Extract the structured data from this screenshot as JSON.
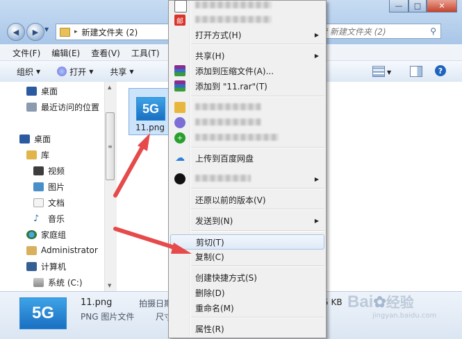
{
  "window": {
    "breadcrumb": "新建文件夹 (2)",
    "search_placeholder": "搜索 新建文件夹 (2)",
    "minimize": "—",
    "maximize": "□",
    "close": "✕"
  },
  "menubar": [
    "文件(F)",
    "编辑(E)",
    "查看(V)",
    "工具(T)"
  ],
  "toolbar": {
    "organize": "组织",
    "open": "打开",
    "share": "共享"
  },
  "navpane": {
    "favorites": [
      "桌面",
      "最近访问的位置"
    ],
    "tree": [
      "桌面",
      "库",
      "视频",
      "图片",
      "文档",
      "音乐",
      "家庭组",
      "Administrator",
      "计算机",
      "系统 (C:)"
    ]
  },
  "file": {
    "name": "11.png",
    "thumb_text": "5G"
  },
  "details": {
    "name": "11.png",
    "type": "PNG 图片文件",
    "date_label": "拍摄日期",
    "dims_label": "尺寸",
    "size": "5 KB",
    "thumb_text": "5G"
  },
  "context_menu": {
    "open_with": "打开方式(H)",
    "share": "共享(H)",
    "add_archive": "添加到压缩文件(A)...",
    "add_rar": "添加到 \"11.rar\"(T)",
    "upload_baidu": "上传到百度网盘",
    "restore": "还原以前的版本(V)",
    "send_to": "发送到(N)",
    "cut": "剪切(T)",
    "copy": "复制(C)",
    "create_shortcut": "创建快捷方式(S)",
    "delete": "删除(D)",
    "rename": "重命名(M)",
    "properties": "属性(R)"
  },
  "watermark": {
    "brand": "Bai",
    "brand2": "经验",
    "url": "jingyan.baidu.com"
  },
  "colors": {
    "arrow": "#e64a4a",
    "highlight": "#dfeaf7",
    "titlebar": "#b6cfee"
  }
}
